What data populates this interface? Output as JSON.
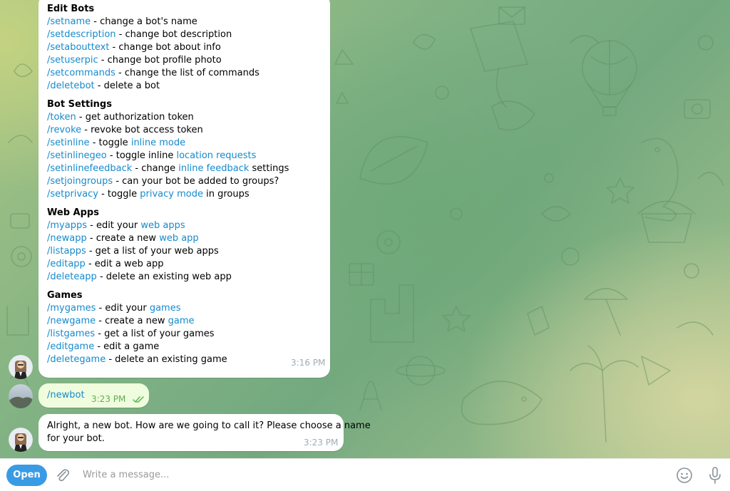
{
  "colors": {
    "link": "#168acd",
    "open_button": "#3a9be5",
    "outgoing_bubble": "#effdde",
    "check": "#5fb256"
  },
  "bot_help": {
    "sections": [
      {
        "title": "Edit Bots",
        "items": [
          {
            "cmd": "/setname",
            "text": " - change a bot's name"
          },
          {
            "cmd": "/setdescription",
            "text": " - change bot description"
          },
          {
            "cmd": "/setabouttext",
            "text": " - change bot about info"
          },
          {
            "cmd": "/setuserpic",
            "text": " - change bot profile photo"
          },
          {
            "cmd": "/setcommands",
            "text": " - change the list of commands"
          },
          {
            "cmd": "/deletebot",
            "text": " - delete a bot"
          }
        ]
      },
      {
        "title": "Bot Settings",
        "items": [
          {
            "cmd": "/token",
            "text": " - get authorization token"
          },
          {
            "cmd": "/revoke",
            "text": " - revoke bot access token"
          },
          {
            "cmd": "/setinline",
            "text": " - toggle ",
            "link": "inline mode",
            "after": ""
          },
          {
            "cmd": "/setinlinegeo",
            "text": " - toggle inline ",
            "link": "location requests",
            "after": ""
          },
          {
            "cmd": "/setinlinefeedback",
            "text": " - change ",
            "link": "inline feedback",
            "after": " settings"
          },
          {
            "cmd": "/setjoingroups",
            "text": " - can your bot be added to groups?"
          },
          {
            "cmd": "/setprivacy",
            "text": " - toggle ",
            "link": "privacy mode",
            "after": " in groups"
          }
        ]
      },
      {
        "title": "Web Apps",
        "items": [
          {
            "cmd": "/myapps",
            "text": " - edit your ",
            "link": "web apps",
            "after": ""
          },
          {
            "cmd": "/newapp",
            "text": " - create a new ",
            "link": "web app",
            "after": ""
          },
          {
            "cmd": "/listapps",
            "text": " - get a list of your web apps"
          },
          {
            "cmd": "/editapp",
            "text": " - edit a web app"
          },
          {
            "cmd": "/deleteapp",
            "text": " - delete an existing web app"
          }
        ]
      },
      {
        "title": "Games",
        "items": [
          {
            "cmd": "/mygames",
            "text": " - edit your ",
            "link": "games",
            "after": ""
          },
          {
            "cmd": "/newgame",
            "text": " - create a new ",
            "link": "game",
            "after": ""
          },
          {
            "cmd": "/listgames",
            "text": " - get a list of your games"
          },
          {
            "cmd": "/editgame",
            "text": " - edit a game"
          },
          {
            "cmd": "/deletegame",
            "text": " - delete an existing game"
          }
        ]
      }
    ],
    "time": "3:16 PM"
  },
  "user_message": {
    "text": "/newbot",
    "time": "3:23 PM",
    "status": "read"
  },
  "bot_reply": {
    "line1": "Alright, a new bot. How are we going to call it? Please choose a name",
    "line2": "for your bot.",
    "time": "3:23 PM"
  },
  "composer": {
    "open_label": "Open",
    "placeholder": "Write a message...",
    "value": "",
    "icons": [
      "attach-icon",
      "emoji-icon",
      "microphone-icon"
    ]
  }
}
